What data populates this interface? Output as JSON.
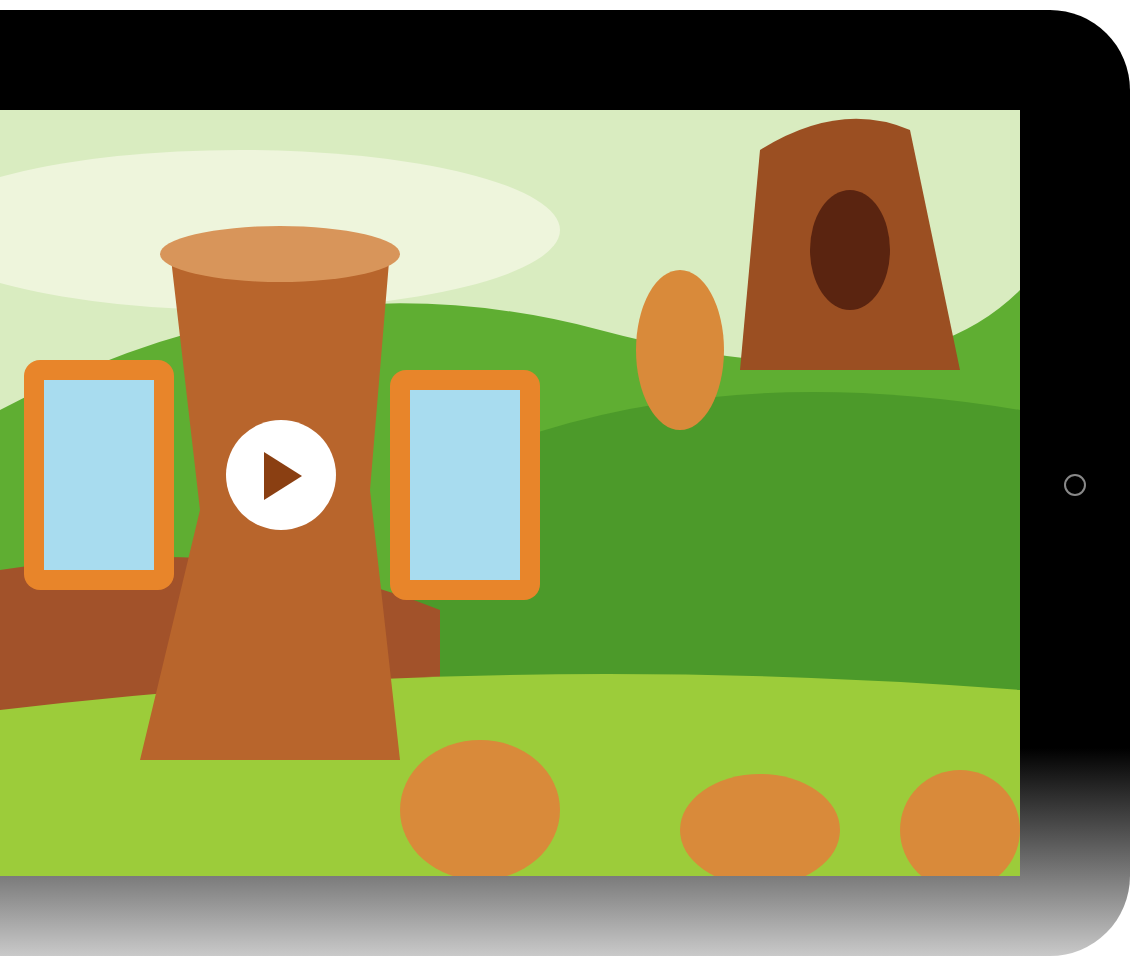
{
  "video": {
    "kind": "picture",
    "paused": true
  }
}
